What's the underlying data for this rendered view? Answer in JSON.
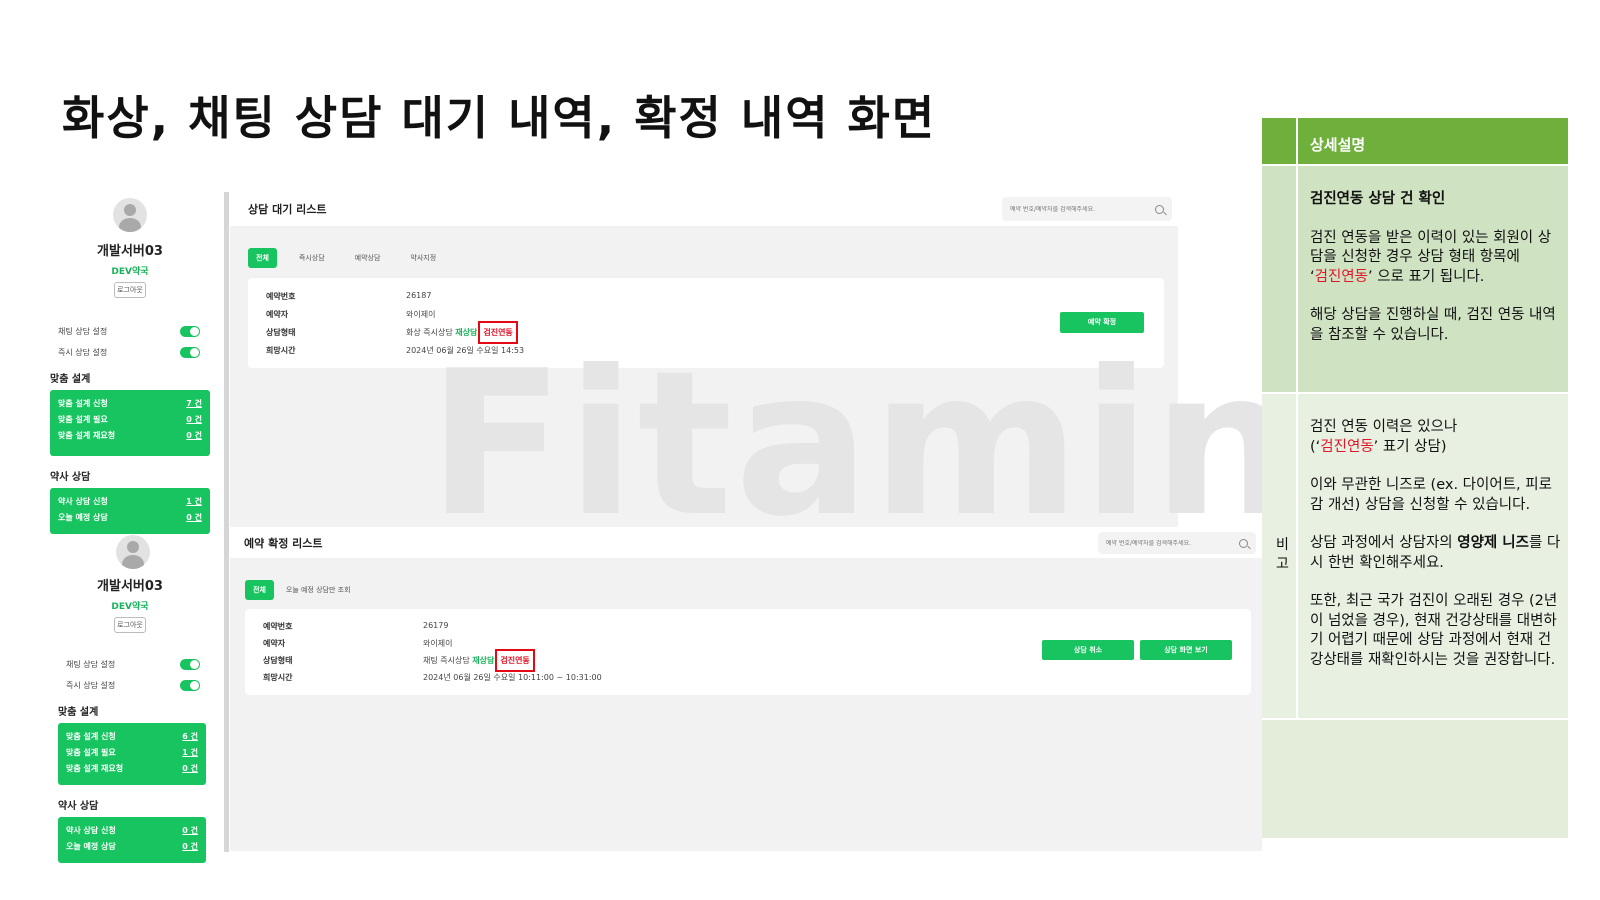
{
  "slide": {
    "title": "화상, 채팅 상담 대기 내역, 확정 내역 화면"
  },
  "sidebar": {
    "name": "개발서버03",
    "org": "DEV약국",
    "logout": "로그아웃",
    "toggles": [
      {
        "label": "채팅 상담 설정",
        "on": true
      },
      {
        "label": "즉시 상담 설정",
        "on": true
      }
    ],
    "custom_section": "맞춤 설계",
    "pharm_section": "약사 상담"
  },
  "sidebar1": {
    "custom_items": [
      {
        "label": "맞춤 설계 신청",
        "count": "7 건"
      },
      {
        "label": "맞춤 설계 필요",
        "count": "0 건"
      },
      {
        "label": "맞춤 설계 재요청",
        "count": "0 건"
      }
    ],
    "pharm_items": [
      {
        "label": "약사 상담 신청",
        "count": "1 건"
      },
      {
        "label": "오늘 예정 상담",
        "count": "0 건"
      }
    ]
  },
  "sidebar2": {
    "custom_items": [
      {
        "label": "맞춤 설계 신청",
        "count": "6 건"
      },
      {
        "label": "맞춤 설계 필요",
        "count": "1 건"
      },
      {
        "label": "맞춤 설계 재요청",
        "count": "0 건"
      }
    ],
    "pharm_items": [
      {
        "label": "약사 상담 신청",
        "count": "0 건"
      },
      {
        "label": "오늘 예정 상담",
        "count": "0 건"
      }
    ]
  },
  "watermark": "Fitamin",
  "waiting": {
    "title": "상담 대기 리스트",
    "search_placeholder": "예약 번호/예약자를 검색해주세요.",
    "tabs": [
      "전체",
      "즉시상담",
      "예약상담",
      "약사지정"
    ],
    "labels": {
      "no": "예약번호",
      "name": "예약자",
      "type": "상담형태",
      "time": "희망시간"
    },
    "item": {
      "no": "26187",
      "name": "와이제이",
      "type_main": "화상 즉시상담",
      "type_re": "재상담",
      "type_link": "검진연동",
      "time": "2024년 06월 26일 수요일 14:53"
    },
    "confirm_btn": "예약 확정"
  },
  "confirmed": {
    "title": "예약 확정 리스트",
    "search_placeholder": "예약 번호/예약자를 검색해주세요.",
    "tabs": [
      "전체",
      "오늘 예정 상담만 조회"
    ],
    "labels": {
      "no": "예약번호",
      "name": "예약자",
      "type": "상담형태",
      "time": "희망시간"
    },
    "item": {
      "no": "26179",
      "name": "와이제이",
      "type_main": "채팅 즉시상담",
      "type_re": "재상담",
      "type_link": "검진연동",
      "time": "2024년 06월 26일 수요일 10:11:00 ~ 10:31:00"
    },
    "cancel_btn": "상담 취소",
    "view_btn": "상담 화면 보기"
  },
  "desc": {
    "header": "상세설명",
    "bigo": "비고",
    "block1_title": "검진연동 상담 건 확인",
    "block1_p1_a": "검진 연동을 받은 이력이 있는 회원이 상담을 신청한 경우 상담 형태 항목에",
    "block1_p1_q1": "‘",
    "block1_p1_red": "검진연동",
    "block1_p1_b": "’ 으로 표기 됩니다.",
    "block1_p2": "해당 상담을 진행하실 때, 검진 연동 내역을 참조할 수 있습니다.",
    "block2_p1_a": "검진 연동 이력은 있으나",
    "block2_p1_b": "(‘",
    "block2_p1_red": "검진연동",
    "block2_p1_c": "’ 표기 상담)",
    "block2_p2": "이와 무관한 니즈로 (ex. 다이어트, 피로감 개선)  상담을 신청할 수 있습니다.",
    "block2_p3_a": "상담 과정에서 상담자의 ",
    "block2_p3_bold": "영양제 니즈",
    "block2_p3_b": "를 다시 한번 확인해주세요.",
    "block2_p4": "또한, 최근 국가 검진이 오래된 경우 (2년이 넘었을 경우), 현재 건강상태를 대변하기 어렵기 때문에 상담 과정에서 현재 건강상태를 재확인하시는 것을 권장합니다."
  },
  "colors": {
    "accent": "#17c45f",
    "highlight": "#e50914",
    "desc_header": "#6fb03d"
  }
}
